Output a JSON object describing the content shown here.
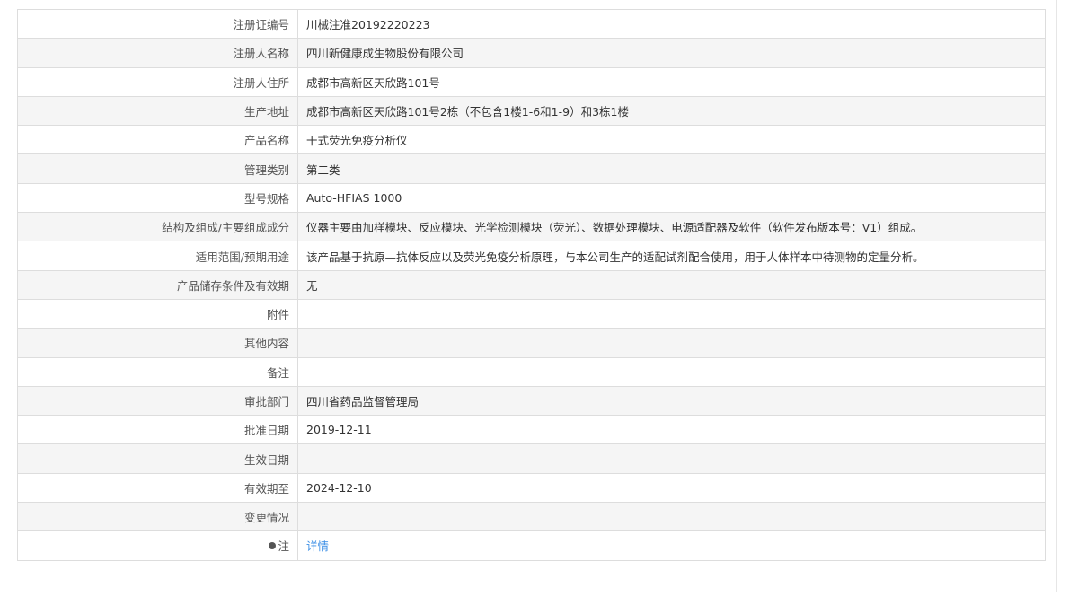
{
  "rows": [
    {
      "label": "注册证编号",
      "value": "川械注准20192220223"
    },
    {
      "label": "注册人名称",
      "value": "四川新健康成生物股份有限公司"
    },
    {
      "label": "注册人住所",
      "value": "成都市高新区天欣路101号"
    },
    {
      "label": "生产地址",
      "value": "成都市高新区天欣路101号2栋（不包含1楼1-6和1-9）和3栋1楼"
    },
    {
      "label": "产品名称",
      "value": "干式荧光免疫分析仪"
    },
    {
      "label": "管理类别",
      "value": "第二类"
    },
    {
      "label": "型号规格",
      "value": "Auto-HFIAS 1000"
    },
    {
      "label": "结构及组成/主要组成成分",
      "value": "仪器主要由加样模块、反应模块、光学检测模块（荧光）、数据处理模块、电源适配器及软件（软件发布版本号：V1）组成。"
    },
    {
      "label": "适用范围/预期用途",
      "value": "该产品基于抗原—抗体反应以及荧光免疫分析原理，与本公司生产的适配试剂配合使用，用于人体样本中待测物的定量分析。"
    },
    {
      "label": "产品储存条件及有效期",
      "value": "无"
    },
    {
      "label": "附件",
      "value": ""
    },
    {
      "label": "其他内容",
      "value": ""
    },
    {
      "label": "备注",
      "value": ""
    },
    {
      "label": "审批部门",
      "value": "四川省药品监督管理局"
    },
    {
      "label": "批准日期",
      "value": "2019-12-11"
    },
    {
      "label": "生效日期",
      "value": ""
    },
    {
      "label": "有效期至",
      "value": "2024-12-10"
    },
    {
      "label": "变更情况",
      "value": ""
    }
  ],
  "note": {
    "label": "注",
    "link": "详情"
  },
  "colors": {
    "link": "#3a8ee6",
    "stripe": "#f5f5f5",
    "border": "#dddddd"
  }
}
